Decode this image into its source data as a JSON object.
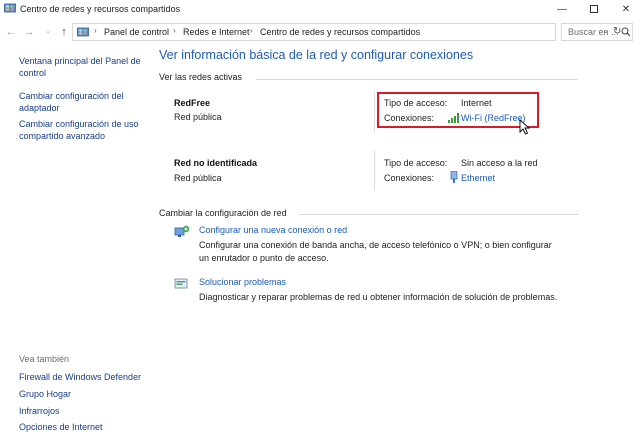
{
  "window": {
    "title": "Centro de redes y recursos compartidos",
    "minimize_label": "—",
    "close_label": "✕"
  },
  "address": {
    "crumbs": [
      "Panel de control",
      "Redes e Internet",
      "Centro de redes y recursos compartidos"
    ],
    "search_placeholder": "Buscar en ..."
  },
  "sidebar": {
    "items": [
      {
        "label": "Ventana principal del Panel de control"
      },
      {
        "label": "Cambiar configuración del adaptador"
      },
      {
        "label": "Cambiar configuración de uso compartido avanzado"
      }
    ],
    "see_also_label": "Vea también",
    "see_also": [
      {
        "label": "Firewall de Windows Defender"
      },
      {
        "label": "Grupo Hogar"
      },
      {
        "label": "Infrarrojos"
      },
      {
        "label": "Opciones de Internet"
      }
    ]
  },
  "main": {
    "title": "Ver información básica de la red y configurar conexiones",
    "active_networks_label": "Ver las redes activas",
    "networks": [
      {
        "name": "RedFree",
        "type": "Red pública",
        "access_label": "Tipo de acceso:",
        "access_value": "Internet",
        "connections_label": "Conexiones:",
        "connection": "Wi-Fi (RedFree)"
      },
      {
        "name": "Red no identificada",
        "type": "Red pública",
        "access_label": "Tipo de acceso:",
        "access_value": "Sin acceso a la red",
        "connections_label": "Conexiones:",
        "connection": "Ethernet"
      }
    ],
    "change_settings_label": "Cambiar la configuración de red",
    "tasks": [
      {
        "link": "Configurar una nueva conexión o red",
        "desc": "Configurar una conexión de banda ancha, de acceso telefónico o VPN; o bien configurar un enrutador o punto de acceso."
      },
      {
        "link": "Solucionar problemas",
        "desc": "Diagnosticar y reparar problemas de red u obtener información de solución de problemas."
      }
    ]
  },
  "colors": {
    "link": "#1a5bbf",
    "heading": "#1e5bb4",
    "highlight_border": "#d71b29"
  },
  "icons": [
    "control-panel-icon",
    "back-arrow-icon",
    "forward-arrow-icon",
    "up-arrow-icon",
    "refresh-icon",
    "search-icon",
    "wifi-signal-icon",
    "ethernet-icon",
    "new-connection-icon",
    "troubleshoot-icon",
    "mouse-cursor-icon"
  ]
}
